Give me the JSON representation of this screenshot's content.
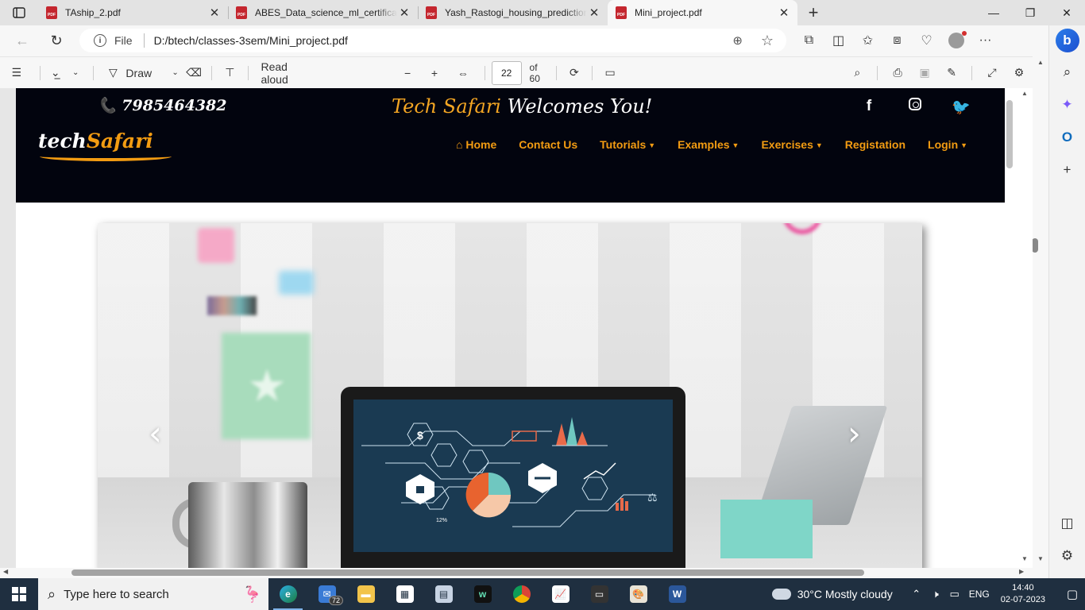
{
  "browser": {
    "tabs": [
      {
        "title": "TAship_2.pdf",
        "active": false
      },
      {
        "title": "ABES_Data_science_ml_certificate",
        "active": false
      },
      {
        "title": "Yash_Rastogi_housing_prediction",
        "active": false
      },
      {
        "title": "Mini_project.pdf",
        "active": true
      }
    ],
    "pdf_icon_label": "PDF",
    "file_label": "File",
    "url": "D:/btech/classes-3sem/Mini_project.pdf"
  },
  "pdf_toolbar": {
    "draw_label": "Draw",
    "read_aloud_label": "Read aloud",
    "page_number": "22",
    "page_total": "of 60"
  },
  "site": {
    "phone": "7985464382",
    "welcome_part1": "Tech Safari",
    "welcome_part2": "Welcomes You!",
    "logo_part1": "tech",
    "logo_part2": "Safari",
    "nav": [
      {
        "label": "Home",
        "icon": "home-icon",
        "dropdown": false
      },
      {
        "label": "Contact Us",
        "dropdown": false
      },
      {
        "label": "Tutorials",
        "dropdown": true
      },
      {
        "label": "Examples",
        "dropdown": true
      },
      {
        "label": "Exercises",
        "dropdown": true
      },
      {
        "label": "Registation",
        "dropdown": false
      },
      {
        "label": "Login",
        "dropdown": true
      }
    ],
    "socials": [
      "facebook-icon",
      "instagram-icon",
      "twitter-icon"
    ],
    "carousel": {
      "screen_label": "12%",
      "prev_icon": "chevron-left-icon",
      "next_icon": "chevron-right-icon"
    }
  },
  "taskbar": {
    "search_placeholder": "Type here to search",
    "mail_badge": "72",
    "weather": "30°C  Mostly cloudy",
    "language": "ENG",
    "time": "14:40",
    "date": "02-07-2023"
  },
  "colors": {
    "accent_orange": "#f39c12",
    "header_bg": "#02040e",
    "taskbar_bg": "#1f2f40"
  }
}
